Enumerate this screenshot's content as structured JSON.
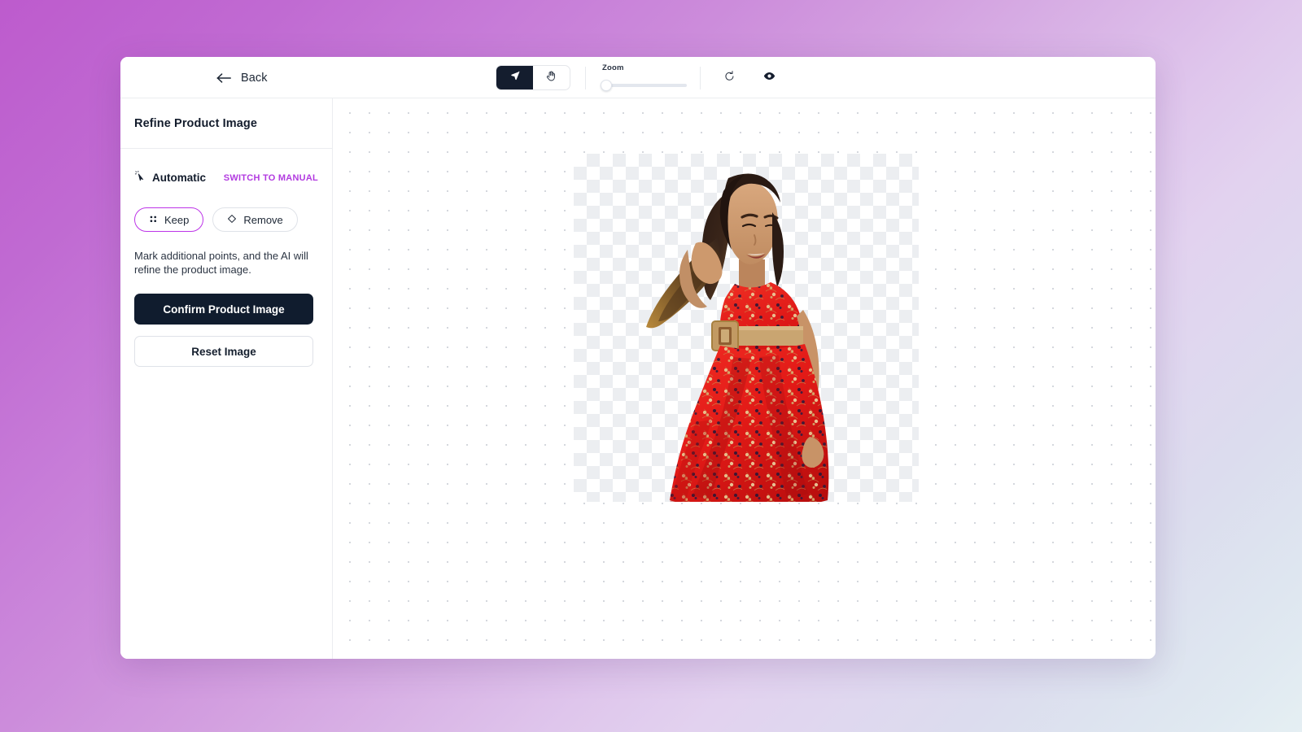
{
  "header": {
    "back_label": "Back",
    "back_icon": "arrow-left-icon",
    "tools": [
      {
        "name": "select-tool",
        "icon": "cursor-arrow-icon",
        "active": true
      },
      {
        "name": "pan-tool",
        "icon": "hand-icon",
        "active": false
      }
    ],
    "zoom": {
      "label": "Zoom",
      "value": 0,
      "min": 0,
      "max": 100
    },
    "reset_view_icon": "rotate-ccw-icon",
    "preview_icon": "eye-icon"
  },
  "sidebar": {
    "title": "Refine Product Image",
    "mode": {
      "icon": "magic-cursor-icon",
      "label": "Automatic",
      "switch_label": "SWITCH TO MANUAL"
    },
    "pills": [
      {
        "label": "Keep",
        "icon": "dots-grid-icon",
        "selected": true
      },
      {
        "label": "Remove",
        "icon": "eraser-icon",
        "selected": false
      }
    ],
    "hint": "Mark additional points, and the AI will refine the product image.",
    "confirm_label": "Confirm Product Image",
    "reset_label": "Reset Image"
  },
  "canvas": {
    "artboard": {
      "transparent_checker": true,
      "subject": "woman in red floral dress"
    }
  },
  "colors": {
    "accent_purple": "#b23ae0",
    "pill_active_border": "#bd34e8",
    "dark_navy": "#101c2e",
    "dress_red": "#e8201f",
    "belt_tan": "#c9a06a"
  }
}
